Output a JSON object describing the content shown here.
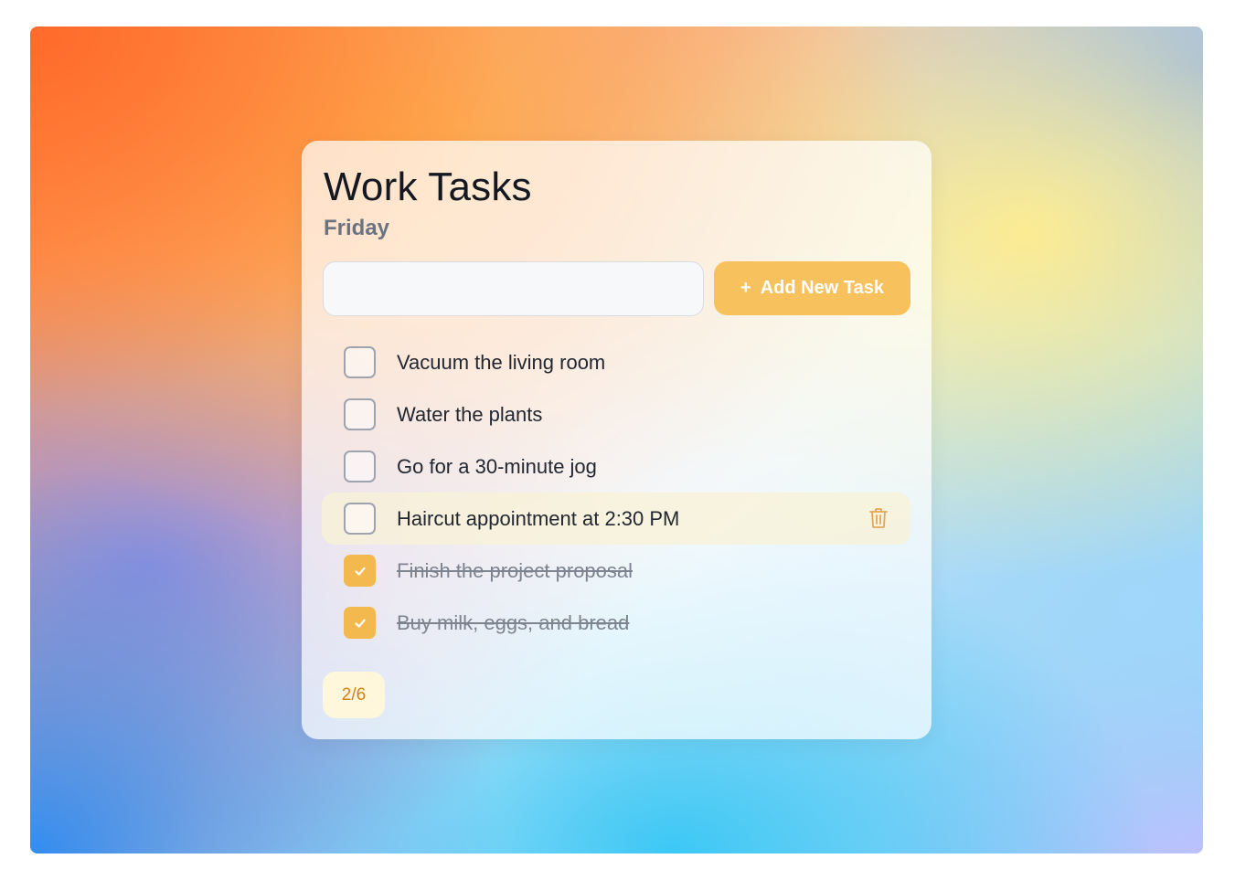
{
  "header": {
    "title": "Work Tasks",
    "subtitle": "Friday"
  },
  "new_task": {
    "value": "",
    "placeholder": "",
    "add_button_icon": "plus-icon",
    "add_button_label": "Add New Task"
  },
  "tasks": [
    {
      "label": "Vacuum the living room",
      "checked": false
    },
    {
      "label": "Water the plants",
      "checked": false
    },
    {
      "label": "Go for a 30-minute jog",
      "checked": false
    },
    {
      "label": "Haircut appointment at 2:30 PM",
      "checked": false,
      "hovered": true,
      "action_icon": "trash-icon"
    },
    {
      "label": "Finish the project proposal",
      "checked": true
    },
    {
      "label": "Buy milk, eggs, and bread",
      "checked": true
    }
  ],
  "footer": {
    "progress": "2/6"
  },
  "colors": {
    "accent": "#f7c25e",
    "checked": "#f4b94e",
    "counter_text": "#d2801b",
    "counter_bg": "#fef7dc",
    "hover_row": "#f8f1d6"
  }
}
